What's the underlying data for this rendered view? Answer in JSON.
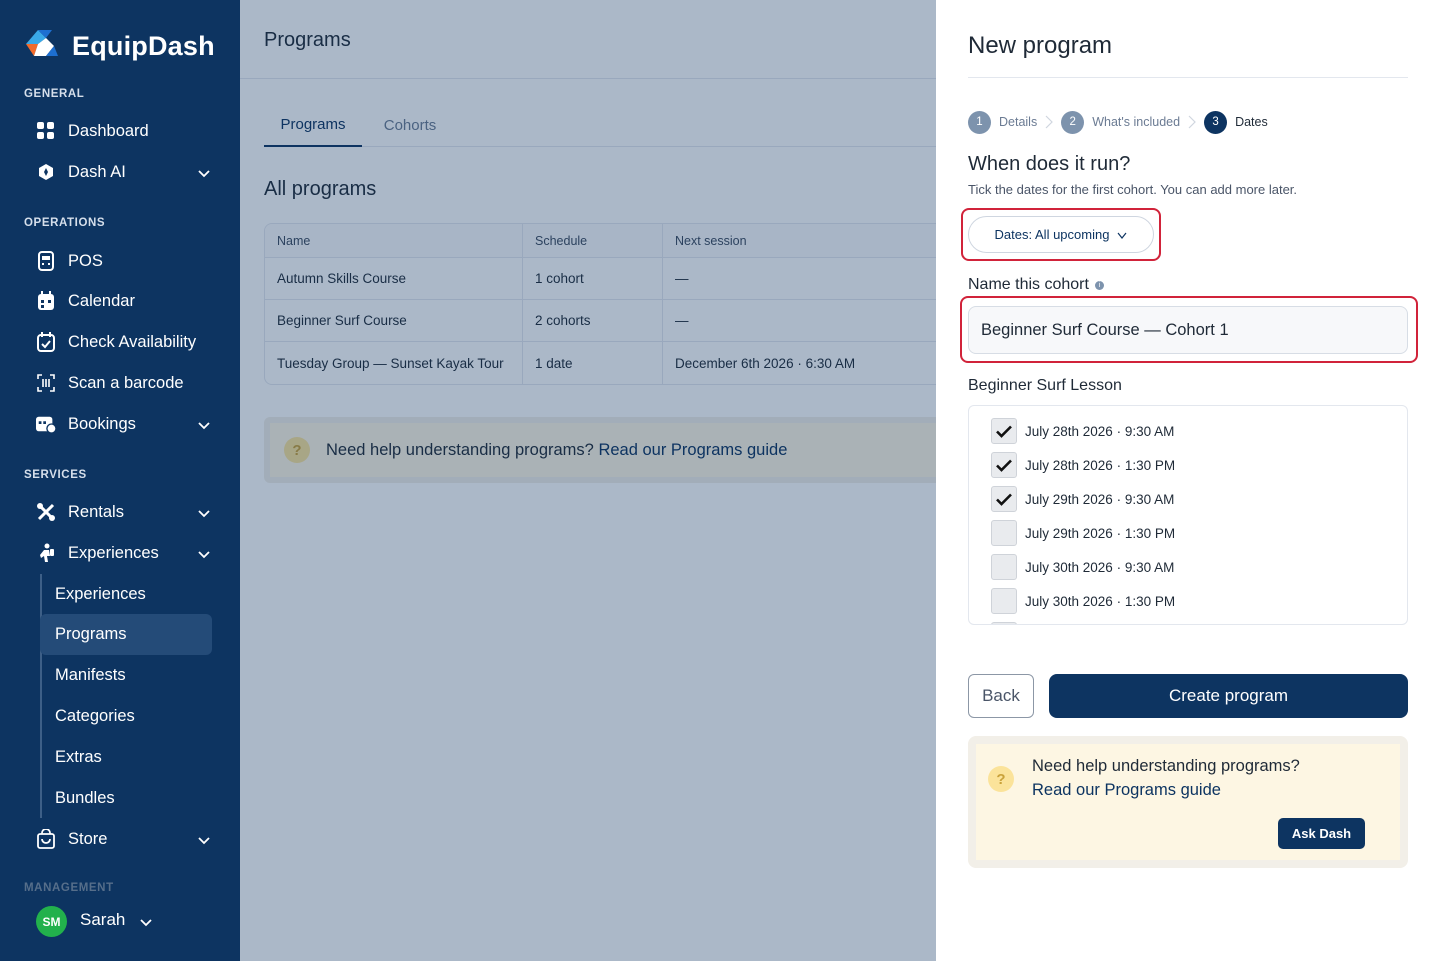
{
  "brand": {
    "name": "EquipDash"
  },
  "sidebar": {
    "sections": {
      "general": "GENERAL",
      "operations": "OPERATIONS",
      "services": "SERVICES",
      "management": "MANAGEMENT"
    },
    "items": {
      "dashboard": "Dashboard",
      "dash_ai": "Dash AI",
      "pos": "POS",
      "calendar": "Calendar",
      "check_availability": "Check Availability",
      "scan_barcode": "Scan a barcode",
      "bookings": "Bookings",
      "rentals": "Rentals",
      "experiences": "Experiences",
      "store": "Store"
    },
    "experiences_sub": [
      "Experiences",
      "Programs",
      "Manifests",
      "Categories",
      "Extras",
      "Bundles"
    ],
    "active_sub": "Programs",
    "user": {
      "initials": "SM",
      "name": "Sarah"
    }
  },
  "main": {
    "title": "Programs",
    "tabs": [
      "Programs",
      "Cohorts"
    ],
    "active_tab": "Programs",
    "section_title": "All programs",
    "table": {
      "headers": [
        "Name",
        "Schedule",
        "Next session"
      ],
      "rows": [
        [
          "Autumn Skills Course",
          "1 cohort",
          "—"
        ],
        [
          "Beginner Surf Course",
          "2 cohorts",
          "—"
        ],
        [
          "Tuesday Group — Sunset Kayak Tour",
          "1 date",
          "December 6th 2026 · 6:30 AM"
        ]
      ]
    },
    "help": {
      "text": "Need help understanding programs?",
      "link": "Read our Programs guide"
    }
  },
  "drawer": {
    "title": "New program",
    "steps": [
      {
        "num": "1",
        "label": "Details"
      },
      {
        "num": "2",
        "label": "What's included"
      },
      {
        "num": "3",
        "label": "Dates"
      }
    ],
    "current_step": 3,
    "question": "When does it run?",
    "subtitle": "Tick the dates for the first cohort. You can add more later.",
    "dates_filter": "Dates: All upcoming",
    "name_label": "Name this cohort",
    "name_value": "Beginner Surf Course — Cohort 1",
    "lesson_label": "Beginner Surf Lesson",
    "dates": [
      {
        "label": "July 28th 2026 · 9:30 AM",
        "checked": true
      },
      {
        "label": "July 28th 2026 · 1:30 PM",
        "checked": true
      },
      {
        "label": "July 29th 2026 · 9:30 AM",
        "checked": true
      },
      {
        "label": "July 29th 2026 · 1:30 PM",
        "checked": false
      },
      {
        "label": "July 30th 2026 · 9:30 AM",
        "checked": false
      },
      {
        "label": "July 30th 2026 · 1:30 PM",
        "checked": false
      }
    ],
    "back_label": "Back",
    "create_label": "Create program",
    "help": {
      "line1": "Need help understanding programs?",
      "link": "Read our Programs guide",
      "ask_label": "Ask Dash"
    }
  },
  "colors": {
    "navy": "#0d3461",
    "highlight_red": "#d1233a",
    "help_bg": "#fdf6e3",
    "avatar_green": "#22b14c"
  }
}
